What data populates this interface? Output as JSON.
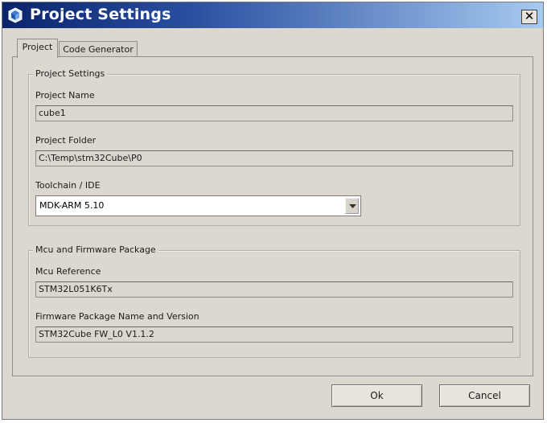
{
  "window": {
    "title": "Project Settings",
    "close_glyph": "✕"
  },
  "tabs": [
    {
      "label": "Project",
      "active": true
    },
    {
      "label": "Code Generator",
      "active": false
    }
  ],
  "project_settings": {
    "title": "Project Settings",
    "project_name": {
      "label": "Project Name",
      "value": "cube1"
    },
    "project_folder": {
      "label": "Project Folder",
      "value": "C:\\Temp\\stm32Cube\\P0"
    },
    "toolchain": {
      "label": "Toolchain / IDE",
      "value": "MDK-ARM 5.10"
    }
  },
  "mcu_package": {
    "title": "Mcu and Firmware Package",
    "mcu_reference": {
      "label": "Mcu Reference",
      "value": "STM32L051K6Tx"
    },
    "firmware_package": {
      "label": "Firmware Package Name and Version",
      "value": "STM32Cube FW_L0 V1.1.2"
    }
  },
  "buttons": {
    "ok": "Ok",
    "cancel": "Cancel"
  },
  "icons": {
    "app": "cube-icon",
    "close": "close-icon",
    "dropdown": "chevron-down-icon"
  },
  "colors": {
    "titlebar_start": "#0a246a",
    "titlebar_end": "#a6caf0",
    "dialog_bg": "#dcd8d0"
  }
}
